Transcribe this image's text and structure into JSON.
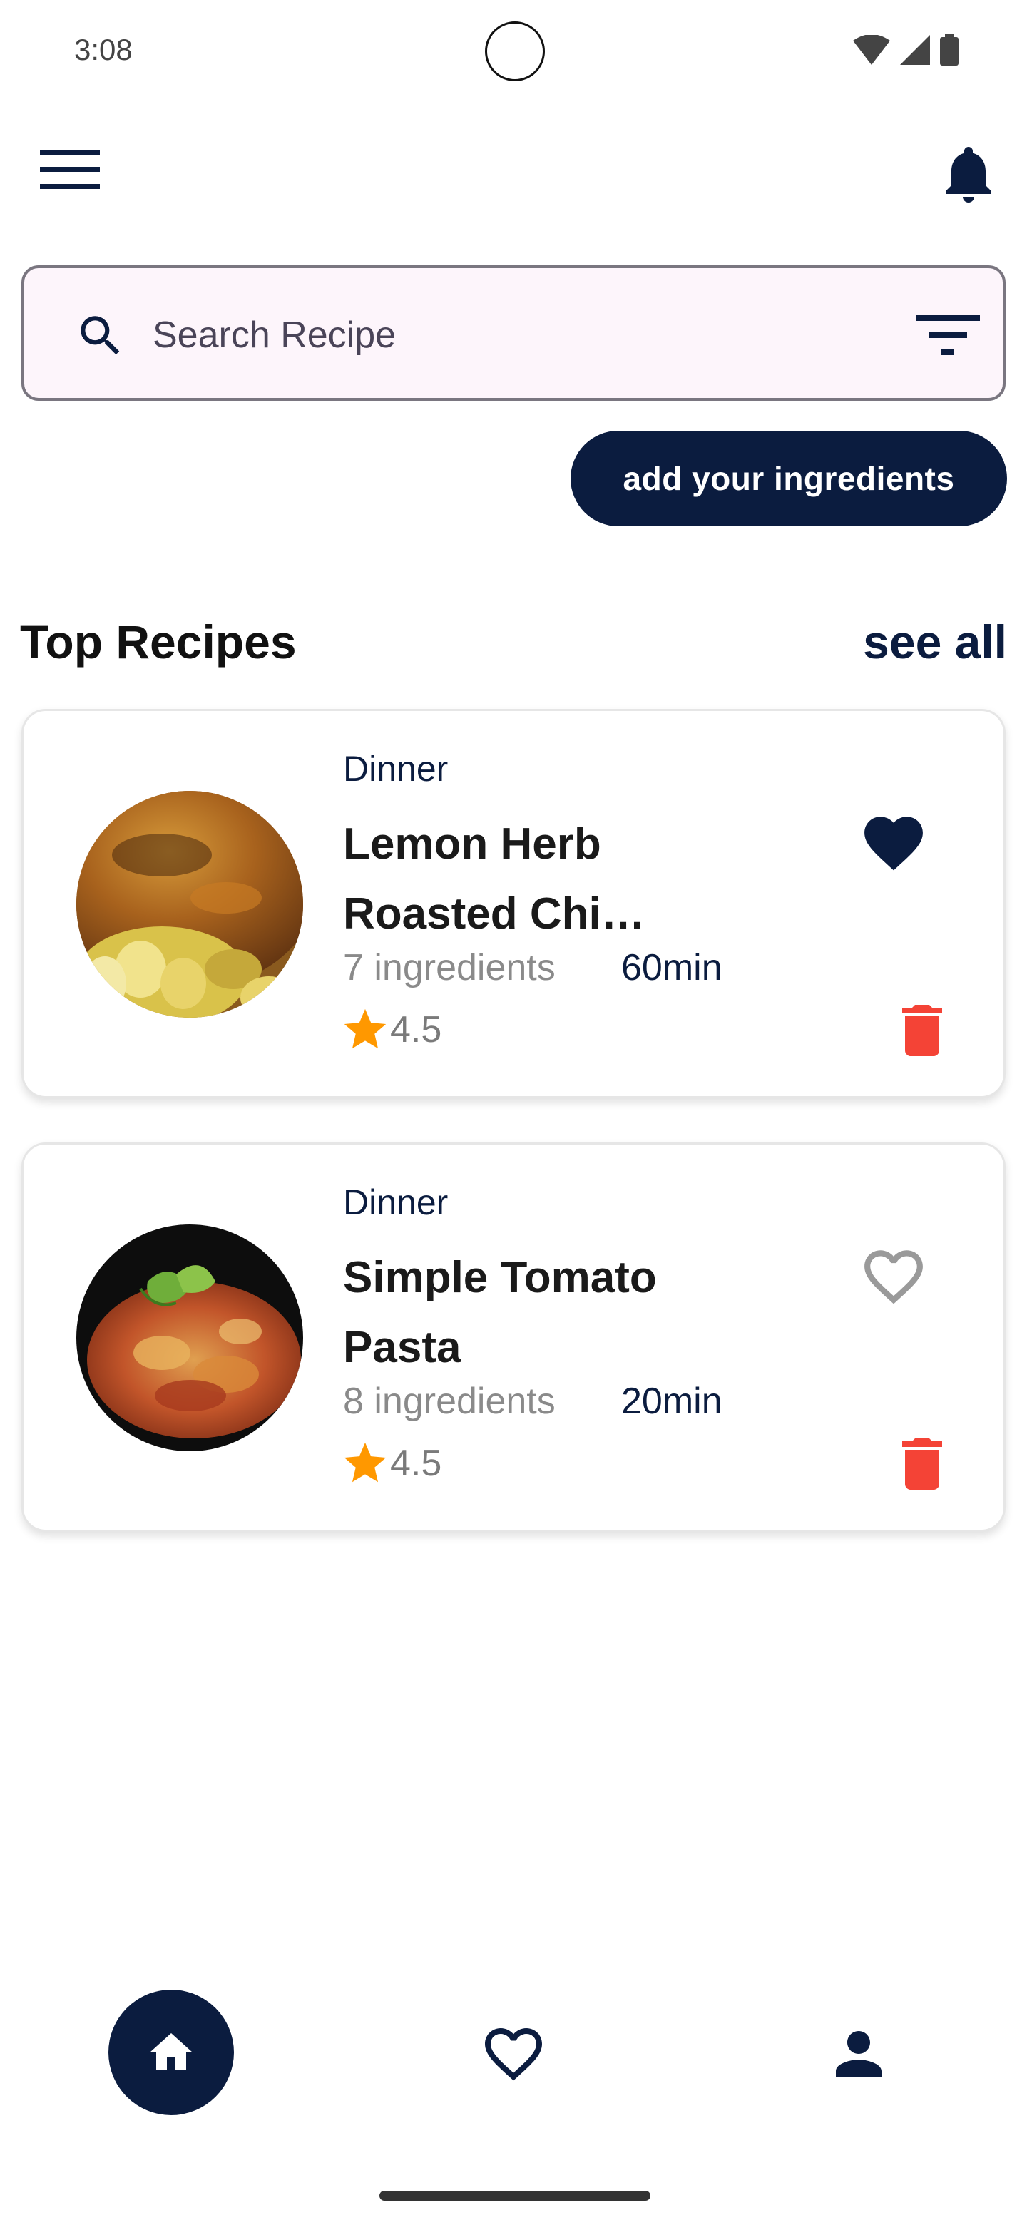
{
  "status_bar": {
    "time": "3:08"
  },
  "search": {
    "placeholder": "Search Recipe",
    "value": ""
  },
  "actions": {
    "add_ingredients_label": "add your ingredients"
  },
  "section": {
    "title": "Top Recipes",
    "see_all_label": "see all"
  },
  "recipes": [
    {
      "category": "Dinner",
      "title": "Lemon Herb Roasted Chi…",
      "ingredients": "7 ingredients",
      "time": "60min",
      "rating": "4.5",
      "favorited": true
    },
    {
      "category": "Dinner",
      "title": "Simple Tomato Pasta",
      "ingredients": "8 ingredients",
      "time": "20min",
      "rating": "4.5",
      "favorited": false
    }
  ],
  "theme": {
    "primary": "#0b1c3f",
    "delete": "#f44336",
    "star": "#ff9800",
    "search_bg": "#fdf5fb"
  },
  "bottom_nav": {
    "items": [
      "home-icon",
      "heart-icon",
      "person-icon"
    ],
    "active": "home-icon"
  }
}
